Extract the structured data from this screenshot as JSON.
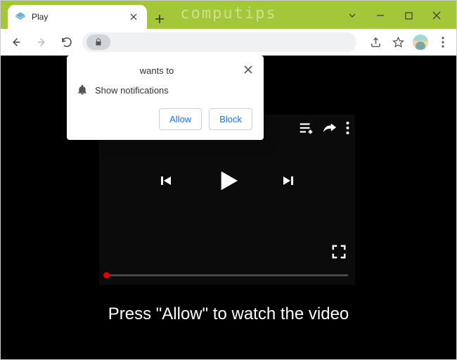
{
  "window": {
    "titlebar_watermark": "computips"
  },
  "tab": {
    "title": "Play"
  },
  "popup": {
    "wants_to": "wants to",
    "show_notifications": "Show notifications",
    "allow": "Allow",
    "block": "Block"
  },
  "page": {
    "caption": "Press \"Allow\" to watch the video"
  }
}
